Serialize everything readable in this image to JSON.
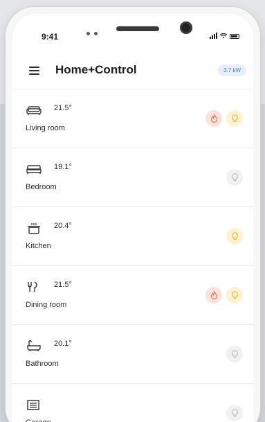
{
  "status_bar": {
    "time": "9:41"
  },
  "header": {
    "title": "Home+Control",
    "power": "3.7 kW"
  },
  "colors": {
    "heating_bg": "#fbe3dc",
    "heating_fg": "#e4774f",
    "light_on_bg": "#fdf3d4",
    "light_on_fg": "#e9b52f",
    "light_off_bg": "#f1f1f3",
    "light_off_fg": "#b9b9be",
    "badge_bg": "#e8eefc",
    "badge_fg": "#4a72d6"
  },
  "rooms": [
    {
      "name": "Living room",
      "temp": "21.5°",
      "icon": "sofa-icon",
      "heating": true,
      "light": "on"
    },
    {
      "name": "Bedroom",
      "temp": "19.1°",
      "icon": "bed-icon",
      "heating": false,
      "light": "off"
    },
    {
      "name": "Kitchen",
      "temp": "20.4°",
      "icon": "cooking-pot-icon",
      "heating": false,
      "light": "on"
    },
    {
      "name": "Dining room",
      "temp": "21.5°",
      "icon": "cutlery-icon",
      "heating": true,
      "light": "on"
    },
    {
      "name": "Bathroom",
      "temp": "20.1°",
      "icon": "bathtub-icon",
      "heating": false,
      "light": "off"
    },
    {
      "name": "Garage",
      "temp": "",
      "icon": "garage-icon",
      "heating": false,
      "light": "off"
    }
  ]
}
